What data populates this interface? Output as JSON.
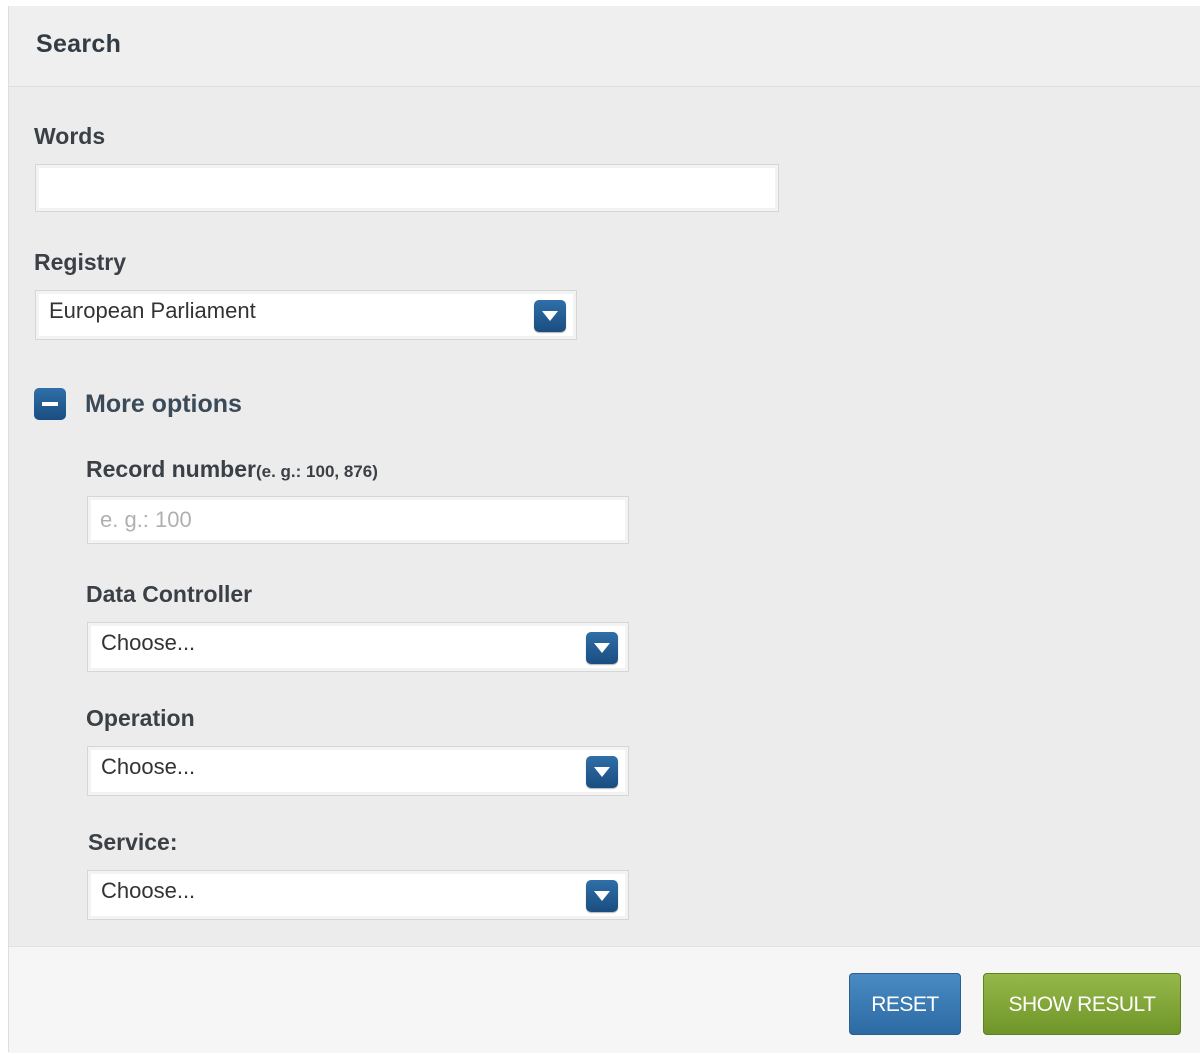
{
  "header": {
    "title": "Search"
  },
  "words": {
    "label": "Words",
    "value": "",
    "placeholder": ""
  },
  "registry": {
    "label": "Registry",
    "selected": "European Parliament"
  },
  "more_options": {
    "label": "More options",
    "state": "expanded"
  },
  "record_number": {
    "label": "Record number",
    "hint": "(e. g.: 100, 876)",
    "placeholder": "e. g.: 100",
    "value": ""
  },
  "data_controller": {
    "label": "Data Controller",
    "selected": "Choose..."
  },
  "operation": {
    "label": "Operation",
    "selected": "Choose..."
  },
  "service": {
    "label": "Service:",
    "selected": "Choose..."
  },
  "footer": {
    "reset_label": "RESET",
    "show_result_label": "SHOW RESULT"
  },
  "colors": {
    "accent_blue": "#2c6aa3",
    "accent_green": "#7a9e32",
    "panel_bg": "#ececec"
  },
  "icons": {
    "select_arrow": "chevron-down-icon",
    "toggle": "minus-icon"
  }
}
